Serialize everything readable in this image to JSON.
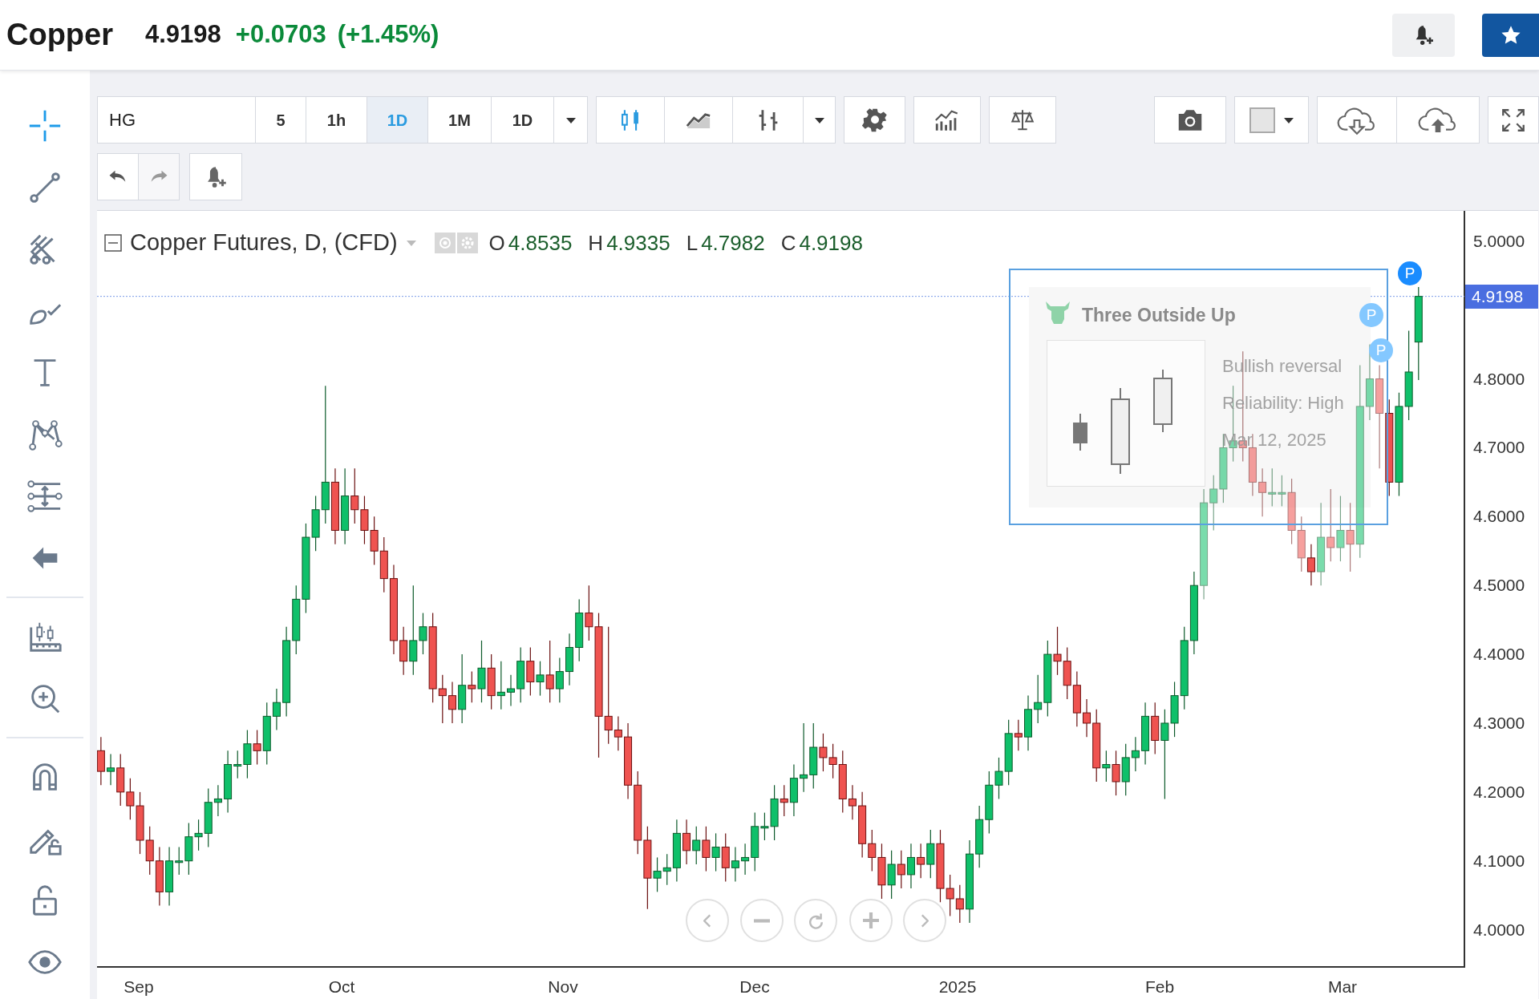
{
  "header": {
    "title": "Copper",
    "price": "4.9198",
    "change": "+0.0703",
    "change_percent": "(+1.45%)"
  },
  "toolbar": {
    "symbol": "HG",
    "intervals": [
      {
        "label": "5",
        "selected": false
      },
      {
        "label": "1h",
        "selected": false
      },
      {
        "label": "1D",
        "selected": true
      },
      {
        "label": "1M",
        "selected": false
      },
      {
        "label": "1D",
        "selected": false
      }
    ],
    "chart_types": [
      {
        "kind": "candles",
        "selected": true
      },
      {
        "kind": "line",
        "selected": false
      },
      {
        "kind": "bars",
        "selected": false
      }
    ]
  },
  "sidebar_groups": [
    {
      "tools": [
        {
          "kind": "crosshair",
          "selected": true
        },
        {
          "kind": "trend-line",
          "selected": false
        },
        {
          "kind": "pitchfork",
          "selected": false
        },
        {
          "kind": "brush",
          "selected": false
        },
        {
          "kind": "text",
          "selected": false
        },
        {
          "kind": "pattern",
          "selected": false
        },
        {
          "kind": "measure",
          "selected": false
        },
        {
          "kind": "collapse",
          "selected": false
        }
      ]
    },
    {
      "tools": [
        {
          "kind": "candles-ruler",
          "selected": false
        },
        {
          "kind": "zoom",
          "selected": false
        }
      ]
    },
    {
      "tools": [
        {
          "kind": "magnet",
          "selected": false
        },
        {
          "kind": "pencil-lock",
          "selected": false
        },
        {
          "kind": "lock",
          "selected": false
        },
        {
          "kind": "eye",
          "selected": false
        }
      ]
    }
  ],
  "legend": {
    "title": "Copper Futures, D, (CFD)",
    "ohlc": [
      {
        "label": "O",
        "value": "4.8535"
      },
      {
        "label": "H",
        "value": "4.9335"
      },
      {
        "label": "L",
        "value": "4.7982"
      },
      {
        "label": "C",
        "value": "4.9198"
      }
    ]
  },
  "last_price": "4.9198",
  "time_axis": [
    "Sep",
    "Oct",
    "Nov",
    "Dec",
    "2025",
    "Feb",
    "Mar"
  ],
  "price_chart": {
    "chart_data": {
      "type": "candlestick",
      "categories": [
        null,
        null,
        null,
        null,
        null,
        null,
        null,
        null,
        null,
        null,
        null,
        null,
        null,
        null,
        null,
        null,
        null,
        null,
        null,
        null,
        null,
        null,
        null,
        null,
        null,
        null,
        null,
        null,
        null,
        null,
        null,
        null,
        null,
        null,
        null,
        null,
        null,
        null,
        null,
        null,
        null,
        null,
        null,
        null,
        null,
        null,
        null,
        null,
        null,
        null,
        null,
        null,
        null,
        null,
        null,
        null,
        null,
        null,
        null,
        null,
        null,
        null,
        null,
        null,
        null,
        null,
        null,
        null,
        null,
        null,
        null,
        null,
        null,
        null,
        null,
        null,
        null,
        null,
        null,
        null,
        null,
        null,
        null,
        null,
        null,
        null,
        null,
        null,
        null,
        null,
        null,
        null,
        null,
        null,
        null,
        null,
        null,
        null,
        null,
        null,
        null,
        null,
        null,
        null,
        null,
        null,
        null,
        null,
        null,
        null,
        null,
        null,
        null,
        null,
        null,
        null,
        null,
        null,
        null,
        null,
        null,
        null,
        null,
        null,
        null,
        null,
        null,
        null,
        null,
        null,
        null,
        null,
        null,
        null,
        null,
        null
      ],
      "ohlc": [
        [
          4.26,
          4.28,
          4.21,
          4.23
        ],
        [
          4.23,
          4.255,
          4.21,
          4.235
        ],
        [
          4.235,
          4.255,
          4.18,
          4.2
        ],
        [
          4.2,
          4.22,
          4.16,
          4.18
        ],
        [
          4.18,
          4.2,
          4.11,
          4.13
        ],
        [
          4.13,
          4.15,
          4.08,
          4.1
        ],
        [
          4.1,
          4.12,
          4.035,
          4.055
        ],
        [
          4.055,
          4.12,
          4.035,
          4.1
        ],
        [
          4.1,
          4.12,
          4.08,
          4.1
        ],
        [
          4.1,
          4.155,
          4.08,
          4.135
        ],
        [
          4.135,
          4.16,
          4.115,
          4.14
        ],
        [
          4.14,
          4.205,
          4.12,
          4.185
        ],
        [
          4.185,
          4.21,
          4.165,
          4.19
        ],
        [
          4.19,
          4.26,
          4.17,
          4.24
        ],
        [
          4.24,
          4.26,
          4.22,
          4.24
        ],
        [
          4.24,
          4.29,
          4.22,
          4.27
        ],
        [
          4.27,
          4.29,
          4.24,
          4.26
        ],
        [
          4.26,
          4.33,
          4.24,
          4.31
        ],
        [
          4.31,
          4.35,
          4.29,
          4.33
        ],
        [
          4.33,
          4.44,
          4.31,
          4.42
        ],
        [
          4.42,
          4.5,
          4.4,
          4.48
        ],
        [
          4.48,
          4.59,
          4.46,
          4.57
        ],
        [
          4.57,
          4.63,
          4.55,
          4.61
        ],
        [
          4.61,
          4.79,
          4.59,
          4.65
        ],
        [
          4.65,
          4.67,
          4.56,
          4.58
        ],
        [
          4.58,
          4.67,
          4.56,
          4.63
        ],
        [
          4.63,
          4.67,
          4.59,
          4.61
        ],
        [
          4.61,
          4.63,
          4.56,
          4.58
        ],
        [
          4.58,
          4.6,
          4.53,
          4.55
        ],
        [
          4.55,
          4.57,
          4.49,
          4.51
        ],
        [
          4.51,
          4.53,
          4.4,
          4.42
        ],
        [
          4.42,
          4.44,
          4.37,
          4.39
        ],
        [
          4.39,
          4.5,
          4.37,
          4.42
        ],
        [
          4.42,
          4.46,
          4.4,
          4.44
        ],
        [
          4.44,
          4.46,
          4.33,
          4.35
        ],
        [
          4.35,
          4.37,
          4.3,
          4.34
        ],
        [
          4.34,
          4.36,
          4.3,
          4.32
        ],
        [
          4.32,
          4.4,
          4.3,
          4.355
        ],
        [
          4.355,
          4.375,
          4.33,
          4.35
        ],
        [
          4.35,
          4.42,
          4.33,
          4.38
        ],
        [
          4.38,
          4.4,
          4.32,
          4.34
        ],
        [
          4.34,
          4.39,
          4.32,
          4.345
        ],
        [
          4.345,
          4.37,
          4.325,
          4.35
        ],
        [
          4.35,
          4.41,
          4.33,
          4.39
        ],
        [
          4.39,
          4.41,
          4.34,
          4.36
        ],
        [
          4.36,
          4.39,
          4.34,
          4.37
        ],
        [
          4.37,
          4.42,
          4.33,
          4.35
        ],
        [
          4.35,
          4.395,
          4.33,
          4.375
        ],
        [
          4.375,
          4.43,
          4.355,
          4.41
        ],
        [
          4.41,
          4.48,
          4.39,
          4.46
        ],
        [
          4.46,
          4.5,
          4.42,
          4.44
        ],
        [
          4.44,
          4.46,
          4.25,
          4.31
        ],
        [
          4.31,
          4.44,
          4.27,
          4.29
        ],
        [
          4.29,
          4.31,
          4.26,
          4.28
        ],
        [
          4.28,
          4.3,
          4.19,
          4.21
        ],
        [
          4.21,
          4.23,
          4.11,
          4.13
        ],
        [
          4.13,
          4.15,
          4.03,
          4.075
        ],
        [
          4.075,
          4.105,
          4.055,
          4.085
        ],
        [
          4.085,
          4.11,
          4.065,
          4.09
        ],
        [
          4.09,
          4.16,
          4.07,
          4.14
        ],
        [
          4.14,
          4.16,
          4.095,
          4.115
        ],
        [
          4.115,
          4.15,
          4.095,
          4.13
        ],
        [
          4.13,
          4.15,
          4.085,
          4.105
        ],
        [
          4.105,
          4.14,
          4.085,
          4.12
        ],
        [
          4.12,
          4.14,
          4.07,
          4.09
        ],
        [
          4.09,
          4.12,
          4.07,
          4.1
        ],
        [
          4.1,
          4.125,
          4.08,
          4.105
        ],
        [
          4.105,
          4.17,
          4.085,
          4.15
        ],
        [
          4.15,
          4.17,
          4.13,
          4.15
        ],
        [
          4.15,
          4.21,
          4.13,
          4.19
        ],
        [
          4.19,
          4.21,
          4.165,
          4.185
        ],
        [
          4.185,
          4.24,
          4.165,
          4.22
        ],
        [
          4.22,
          4.3,
          4.2,
          4.225
        ],
        [
          4.225,
          4.3,
          4.205,
          4.265
        ],
        [
          4.265,
          4.285,
          4.23,
          4.25
        ],
        [
          4.25,
          4.27,
          4.22,
          4.24
        ],
        [
          4.24,
          4.26,
          4.17,
          4.19
        ],
        [
          4.19,
          4.21,
          4.16,
          4.18
        ],
        [
          4.18,
          4.2,
          4.105,
          4.125
        ],
        [
          4.125,
          4.145,
          4.085,
          4.105
        ],
        [
          4.105,
          4.125,
          4.045,
          4.065
        ],
        [
          4.065,
          4.115,
          4.045,
          4.095
        ],
        [
          4.095,
          4.115,
          4.06,
          4.08
        ],
        [
          4.08,
          4.125,
          4.06,
          4.105
        ],
        [
          4.105,
          4.125,
          4.075,
          4.095
        ],
        [
          4.095,
          4.145,
          4.075,
          4.125
        ],
        [
          4.125,
          4.145,
          4.04,
          4.06
        ],
        [
          4.06,
          4.08,
          4.02,
          4.045
        ],
        [
          4.045,
          4.065,
          4.01,
          4.03
        ],
        [
          4.03,
          4.13,
          4.01,
          4.11
        ],
        [
          4.11,
          4.18,
          4.09,
          4.16
        ],
        [
          4.16,
          4.23,
          4.14,
          4.21
        ],
        [
          4.21,
          4.25,
          4.19,
          4.23
        ],
        [
          4.23,
          4.305,
          4.21,
          4.285
        ],
        [
          4.285,
          4.305,
          4.26,
          4.28
        ],
        [
          4.28,
          4.34,
          4.26,
          4.32
        ],
        [
          4.32,
          4.37,
          4.3,
          4.33
        ],
        [
          4.33,
          4.42,
          4.31,
          4.4
        ],
        [
          4.4,
          4.44,
          4.37,
          4.39
        ],
        [
          4.39,
          4.41,
          4.335,
          4.355
        ],
        [
          4.355,
          4.375,
          4.295,
          4.315
        ],
        [
          4.315,
          4.335,
          4.28,
          4.3
        ],
        [
          4.3,
          4.32,
          4.215,
          4.235
        ],
        [
          4.235,
          4.26,
          4.215,
          4.24
        ],
        [
          4.24,
          4.26,
          4.195,
          4.215
        ],
        [
          4.215,
          4.27,
          4.195,
          4.25
        ],
        [
          4.25,
          4.28,
          4.23,
          4.26
        ],
        [
          4.26,
          4.33,
          4.24,
          4.31
        ],
        [
          4.31,
          4.33,
          4.255,
          4.275
        ],
        [
          4.275,
          4.32,
          4.19,
          4.3
        ],
        [
          4.3,
          4.36,
          4.28,
          4.34
        ],
        [
          4.34,
          4.44,
          4.32,
          4.42
        ],
        [
          4.42,
          4.52,
          4.4,
          4.5
        ],
        [
          4.5,
          4.64,
          4.48,
          4.62
        ],
        [
          4.62,
          4.66,
          4.58,
          4.64
        ],
        [
          4.64,
          4.72,
          4.62,
          4.7
        ],
        [
          4.7,
          4.79,
          4.68,
          4.71
        ],
        [
          4.71,
          4.84,
          4.68,
          4.7
        ],
        [
          4.7,
          4.72,
          4.63,
          4.65
        ],
        [
          4.65,
          4.67,
          4.6,
          4.635
        ],
        [
          4.635,
          4.67,
          4.615,
          4.635
        ],
        [
          4.635,
          4.66,
          4.615,
          4.635
        ],
        [
          4.635,
          4.655,
          4.56,
          4.58
        ],
        [
          4.58,
          4.6,
          4.52,
          4.54
        ],
        [
          4.54,
          4.56,
          4.5,
          4.52
        ],
        [
          4.52,
          4.62,
          4.5,
          4.57
        ],
        [
          4.57,
          4.64,
          4.535,
          4.555
        ],
        [
          4.555,
          4.63,
          4.535,
          4.58
        ],
        [
          4.58,
          4.62,
          4.52,
          4.56
        ],
        [
          4.56,
          4.82,
          4.54,
          4.76
        ],
        [
          4.76,
          4.85,
          4.74,
          4.8
        ],
        [
          4.8,
          4.82,
          4.67,
          4.75
        ],
        [
          4.75,
          4.77,
          4.63,
          4.65
        ],
        [
          4.65,
          4.78,
          4.63,
          4.76
        ],
        [
          4.76,
          4.87,
          4.74,
          4.81
        ],
        [
          4.8535,
          4.9335,
          4.7982,
          4.9198
        ]
      ],
      "ylim": [
        3.946,
        5.044
      ],
      "yticks": [
        {
          "value": 5.0,
          "label": "5.0000"
        },
        {
          "value": 4.8,
          "label": "4.8000"
        },
        {
          "value": 4.7,
          "label": "4.7000"
        },
        {
          "value": 4.6,
          "label": "4.6000"
        },
        {
          "value": 4.5,
          "label": "4.5000"
        },
        {
          "value": 4.4,
          "label": "4.4000"
        },
        {
          "value": 4.3,
          "label": "4.3000"
        },
        {
          "value": 4.2,
          "label": "4.2000"
        },
        {
          "value": 4.1,
          "label": "4.1000"
        },
        {
          "value": 4.0,
          "label": "4.0000"
        }
      ],
      "ref_lines": [
        {
          "axis": "y",
          "value": 4.9198
        }
      ]
    }
  },
  "pattern_popup": {
    "title": "Three Outside Up",
    "lines": [
      "Bullish reversal",
      "Reliability: High",
      "Mar 12, 2025"
    ]
  },
  "markers": [
    {
      "label": "P",
      "highlighted": true
    },
    {
      "label": "P",
      "highlighted": false
    },
    {
      "label": "P",
      "highlighted": false
    }
  ]
}
